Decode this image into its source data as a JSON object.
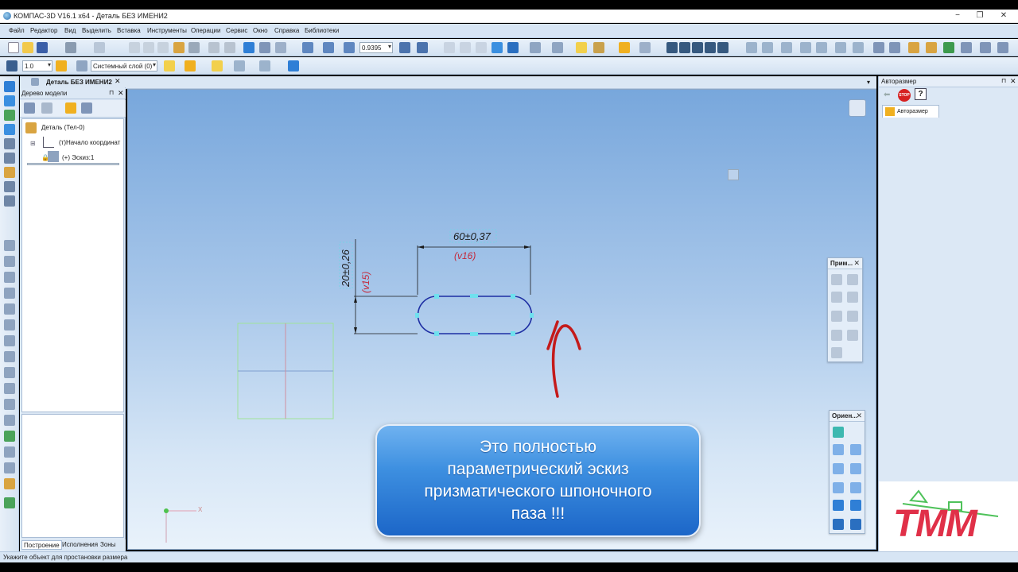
{
  "window": {
    "title": "КОМПАС-3D V16.1 x64 - Деталь БЕЗ ИМЕНИ2",
    "minimize": "−",
    "restore": "❐",
    "close": "✕"
  },
  "menu": [
    "Файл",
    "Редактор",
    "Вид",
    "Выделить",
    "Вставка",
    "Инструменты",
    "Операции",
    "Сервис",
    "Окно",
    "Справка",
    "Библиотеки"
  ],
  "toolbar1": {
    "zoom_value": "0.9395"
  },
  "toolbar2": {
    "scale_value": "1.0",
    "layer_value": "Системный слой (0)"
  },
  "document_tab": {
    "label": "Деталь БЕЗ ИМЕНИ2",
    "close": "✕"
  },
  "tree": {
    "title": "Дерево модели",
    "pin": "⊓",
    "close": "✕",
    "items": [
      {
        "label": "Деталь (Тел-0)"
      },
      {
        "label": "(т)Начало координат"
      },
      {
        "label": "(+) Эскиз:1"
      }
    ],
    "bottom_tabs": [
      "Построение",
      "Исполнения",
      "Зоны"
    ]
  },
  "sketch": {
    "width_dimension": "60±0,37",
    "width_variable": "(v16)",
    "height_dimension": "20±0,26",
    "height_variable": "(v15)",
    "origin_label": "X"
  },
  "callout": {
    "lines": [
      "Это полностью",
      "параметрический  эскиз",
      "призматического шпоночного",
      "паза !!!"
    ]
  },
  "right_panel": {
    "title": "Авторазмер",
    "stop_label": "STOP",
    "help_label": "?",
    "tab_label": "Авторазмер",
    "pin": "⊓",
    "close": "✕"
  },
  "float_panels": {
    "constraints": {
      "title": "Прим...",
      "close": "✕"
    },
    "orientation": {
      "title": "Ориен...",
      "close": "✕"
    }
  },
  "watermark": {
    "text": "ТММ"
  },
  "status": {
    "text": "Укажите объект для простановки размера"
  },
  "colors": {
    "sketch_line": "#1d2ea3",
    "dimension_text": "#1a1a1a",
    "variable_text": "#c4283a",
    "arrow": "#c41a1a",
    "callout": "#2f7fd6",
    "watermark": "#e03048"
  }
}
